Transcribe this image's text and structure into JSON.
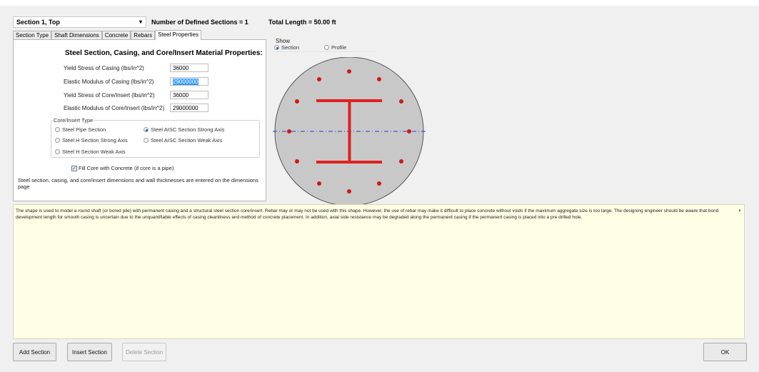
{
  "section_selector": {
    "value": "Section 1, Top"
  },
  "header": {
    "num_sections_text": "Number of Defined Sections = 1",
    "total_length_text": "Total Length = 50.00 ft"
  },
  "tabs": [
    {
      "label": "Section Type"
    },
    {
      "label": "Shaft Dimensions"
    },
    {
      "label": "Concrete"
    },
    {
      "label": "Rebars"
    },
    {
      "label": "Steel Properties",
      "active": true
    }
  ],
  "steel_panel": {
    "title": "Steel Section, Casing, and Core/Insert Material Properties:",
    "fields": [
      {
        "label": "Yield Stress of Casing (lbs/in^2)",
        "value": "36000"
      },
      {
        "label": "Elastic Modulus of Casing (lbs/in^2)",
        "value": "29000000",
        "selected": true
      },
      {
        "label": "Yield Stress of Core/Insert (lbs/in^2)",
        "value": "36000"
      },
      {
        "label": "Elastic Modulus of Core/Insert (lbs/in^2)",
        "value": "29000000"
      }
    ],
    "core_type_legend": "Core/Insert Type",
    "core_types": [
      {
        "label": "Steel Pipe Section",
        "checked": false
      },
      {
        "label": "Steel AISC Section Strong Axis",
        "checked": true
      },
      {
        "label": "Steel H Section Strong Axis",
        "checked": false
      },
      {
        "label": "Steel AISC Section Weak Axis",
        "checked": false
      },
      {
        "label": "Steel H Section Weak Axis",
        "checked": false
      }
    ],
    "fill_core_label": "Fill Core with Concrete (if core is a pipe)",
    "fill_core_checked": true,
    "note": "Steel section, casing, and core/insert dimensions and wall thicknesses are entered on the dimensions page"
  },
  "show": {
    "label": "Show",
    "options": [
      {
        "label": "Section",
        "checked": true
      },
      {
        "label": "Profile",
        "checked": false
      }
    ]
  },
  "diagram_colors": {
    "fill": "#c8c8c8",
    "steel": "#e01f1f",
    "rebar": "#d01818",
    "axis": "#1f3fd6"
  },
  "description": "The shape is used to model a round shaft (or bored pile) with permanent casing and a structural steel section core/insert. Rebar may or may not be used with this shape. However, the use of rebar may make it difficult to place concrete without voids if the maximum aggregate size is too large. The designing engineer should be aware that bond development length for smooth casing is uncertain due to the unquantifiable effects of casing cleanliness and method of concrete placement. In addition, axial side resistance may be degraded along the permanent casing if the permanent casing is placed into a pre drilled hole.",
  "buttons": {
    "add_section": "Add Section",
    "insert_section": "Insert Section",
    "delete_section": "Delete Section",
    "ok": "OK"
  }
}
